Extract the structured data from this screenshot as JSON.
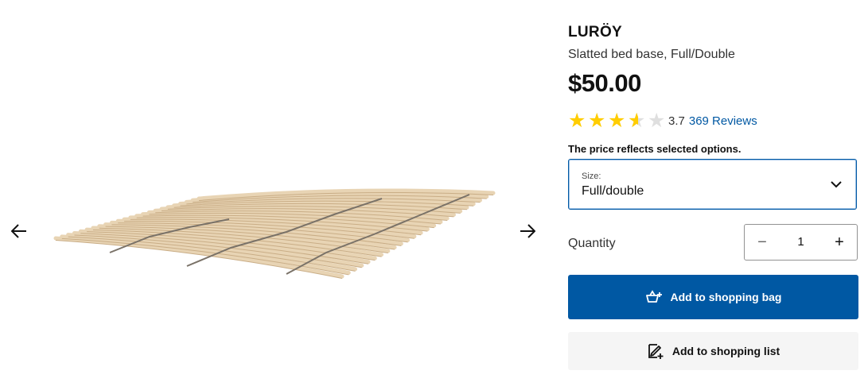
{
  "gallery": {
    "prev_icon": "arrow-left-icon",
    "next_icon": "arrow-right-icon"
  },
  "product": {
    "name": "LURÖY",
    "description": "Slatted bed base, Full/Double",
    "price": "$50.00",
    "rating": 3.7,
    "rating_text": "3.7",
    "reviews_text": "369 Reviews",
    "price_note": "The price reflects selected options."
  },
  "size": {
    "label": "Size:",
    "value": "Full/double"
  },
  "quantity": {
    "label": "Quantity",
    "value": "1",
    "minus": "−",
    "plus": "+"
  },
  "actions": {
    "add_to_bag": "Add to shopping bag",
    "add_to_list": "Add to shopping list"
  },
  "colors": {
    "brand_blue": "#0058a3",
    "star_yellow": "#ffcd00"
  }
}
